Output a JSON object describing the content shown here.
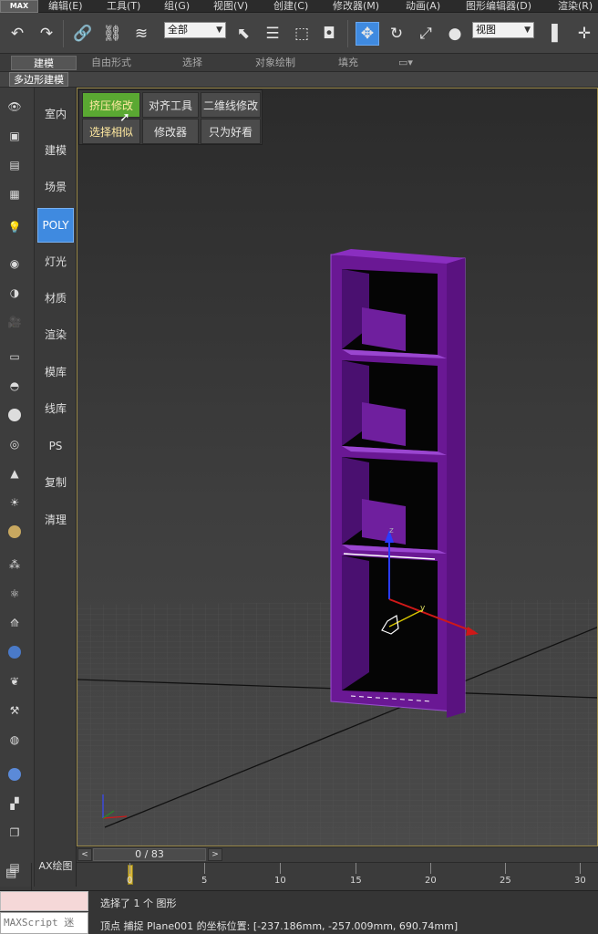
{
  "menu": {
    "logo": "MAX",
    "items": [
      "编辑(E)",
      "工具(T)",
      "组(G)",
      "视图(V)",
      "创建(C)",
      "修改器(M)",
      "动画(A)",
      "图形编辑器(D)",
      "渲染(R)"
    ]
  },
  "toolbar": {
    "selection_filter": "全部",
    "ref_coord": "视图"
  },
  "ribbon": {
    "tabs": [
      "建模",
      "自由形式",
      "选择",
      "对象绘制",
      "填充"
    ],
    "active": "建模",
    "sub_label": "多边形建模"
  },
  "menucol": {
    "items": [
      "室内",
      "建模",
      "场景",
      "POLY",
      "灯光",
      "材质",
      "渲染",
      "模库",
      "线库",
      "PS",
      "复制",
      "清理"
    ],
    "bottom": "AX绘图"
  },
  "popup": {
    "row1": [
      "挤压修改",
      "对齐工具",
      "二维线修改"
    ],
    "row2": [
      "选择相似",
      "修改器",
      "只为好看"
    ]
  },
  "timeline": {
    "frame_display": "0 / 83",
    "prev": "<",
    "next": ">",
    "ticks": [
      "0",
      "5",
      "10",
      "15",
      "20",
      "25",
      "30"
    ]
  },
  "status": {
    "maxscript_placeholder": "MAXScript 迷",
    "line1": "选择了 1 个 图形",
    "line2": "顶点 捕捉 Plane001 的坐标位置:  [-237.186mm, -257.009mm, 690.74mm]"
  },
  "colors": {
    "accent": "#3f8ae0",
    "object": "#7a1ea8",
    "highlight": "#5aa832"
  }
}
